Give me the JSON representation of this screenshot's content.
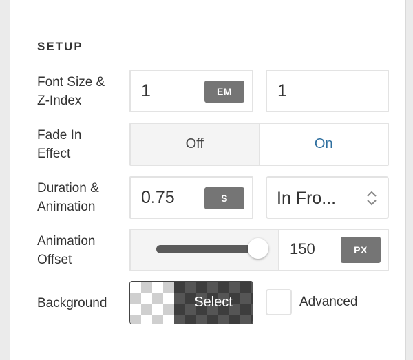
{
  "section": {
    "title": "SETUP"
  },
  "font_size": {
    "label_line1": "Font Size &",
    "label_line2": "Z-Index",
    "value": "1",
    "unit": "EM",
    "z_index": "1"
  },
  "fade_in": {
    "label_line1": "Fade In",
    "label_line2": "Effect",
    "off_label": "Off",
    "on_label": "On",
    "selected": "On"
  },
  "duration": {
    "label_line1": "Duration &",
    "label_line2": "Animation",
    "value": "0.75",
    "unit": "S",
    "animation": "In Fro..."
  },
  "offset": {
    "label_line1": "Animation",
    "label_line2": "Offset",
    "slider_fraction": 1.0,
    "value": "150",
    "unit": "PX"
  },
  "background": {
    "label": "Background",
    "select_label": "Select",
    "advanced_label": "Advanced"
  },
  "colors": {
    "accent_on": "#2f6f9f",
    "unit_badge": "#757575",
    "slider_track": "#5a5a5a"
  }
}
